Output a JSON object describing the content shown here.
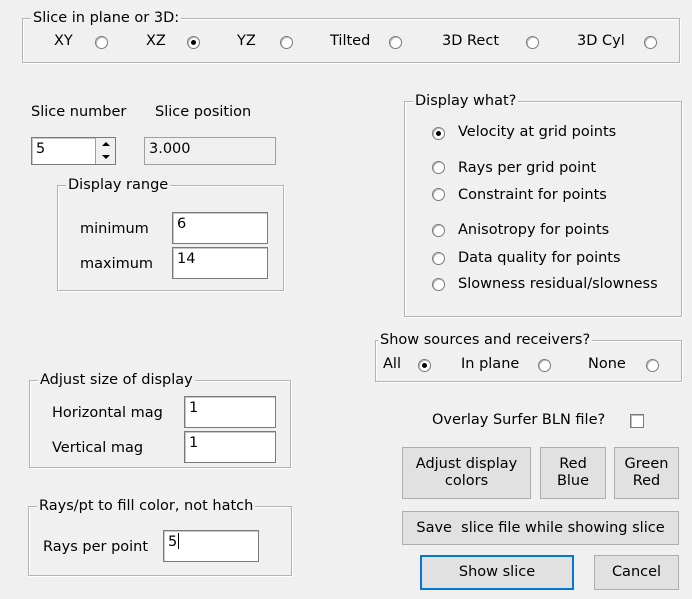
{
  "slice_group": {
    "title": "Slice in plane or 3D:",
    "options": [
      {
        "label": "XY",
        "selected": false
      },
      {
        "label": "XZ",
        "selected": true
      },
      {
        "label": "YZ",
        "selected": false
      },
      {
        "label": "Tilted",
        "selected": false
      },
      {
        "label": "3D Rect",
        "selected": false
      },
      {
        "label": "3D Cyl",
        "selected": false
      }
    ]
  },
  "slice_number_label": "Slice number",
  "slice_number_value": "5",
  "slice_position_label": "Slice position",
  "slice_position_value": "3.000",
  "display_range": {
    "title": "Display range",
    "minimum_label": "minimum",
    "minimum_value": "6",
    "maximum_label": "maximum",
    "maximum_value": "14"
  },
  "display_what": {
    "title": "Display what?",
    "options": [
      {
        "label": "Velocity at grid points",
        "selected": true
      },
      {
        "label": "Rays per grid point",
        "selected": false
      },
      {
        "label": "Constraint for points",
        "selected": false
      },
      {
        "label": "Anisotropy for points",
        "selected": false
      },
      {
        "label": "Data quality for points",
        "selected": false
      },
      {
        "label": "Slowness residual/slowness",
        "selected": false
      }
    ]
  },
  "show_sources": {
    "title": "Show sources and receivers?",
    "options": [
      {
        "label": "All",
        "selected": true
      },
      {
        "label": "In plane",
        "selected": false
      },
      {
        "label": "None",
        "selected": false
      }
    ]
  },
  "adjust_size": {
    "title": "Adjust size of display",
    "horizontal_label": "Horizontal mag",
    "horizontal_value": "1",
    "vertical_label": "Vertical mag",
    "vertical_value": "1"
  },
  "overlay": {
    "label": "Overlay Surfer BLN file?",
    "checked": false
  },
  "buttons": {
    "adjust_colors_line1": "Adjust display",
    "adjust_colors_line2": "colors",
    "red_blue_line1": "Red",
    "red_blue_line2": "Blue",
    "green_red_line1": "Green",
    "green_red_line2": "Red",
    "save_slice": "Save  slice file while showing slice",
    "show_slice": "Show slice",
    "cancel": "Cancel"
  },
  "rays_group": {
    "title": "Rays/pt to fill color, not hatch",
    "label": "Rays per point",
    "value": "5"
  }
}
